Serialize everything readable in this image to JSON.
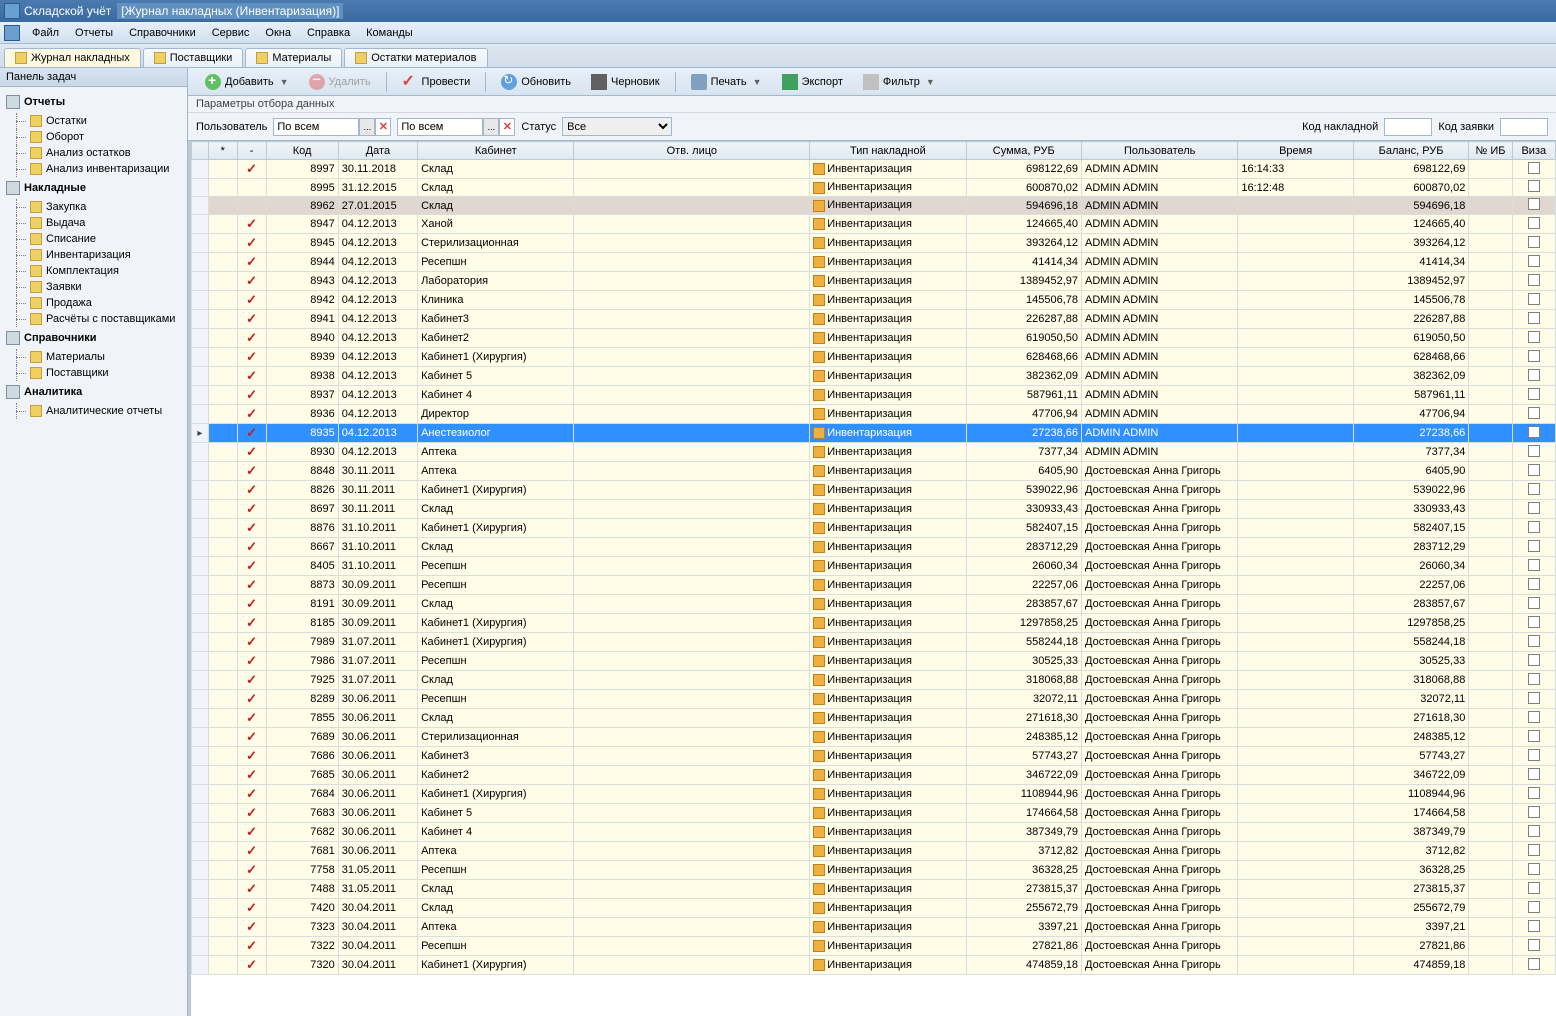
{
  "window": {
    "app_title": "Складской учёт",
    "doc_title": "[Журнал накладных (Инвентаризация)]"
  },
  "menu": [
    "Файл",
    "Отчеты",
    "Справочники",
    "Сервис",
    "Окна",
    "Справка",
    "Команды"
  ],
  "tabs": [
    {
      "label": "Журнал накладных",
      "active": true
    },
    {
      "label": "Поставщики",
      "active": false
    },
    {
      "label": "Материалы",
      "active": false
    },
    {
      "label": "Остатки материалов",
      "active": false
    }
  ],
  "task_panel": {
    "header": "Панель задач",
    "groups": [
      {
        "label": "Отчеты",
        "items": [
          "Остатки",
          "Оборот",
          "Анализ остатков",
          "Анализ инвентаризации"
        ]
      },
      {
        "label": "Накладные",
        "items": [
          "Закупка",
          "Выдача",
          "Списание",
          "Инвентаризация",
          "Комплектация",
          "Заявки",
          "Продажа",
          "Расчёты с поставщиками"
        ]
      },
      {
        "label": "Справочники",
        "items": [
          "Материалы",
          "Поставщики"
        ]
      },
      {
        "label": "Аналитика",
        "items": [
          "Аналитические отчеты"
        ]
      }
    ]
  },
  "toolbar": {
    "add": "Добавить",
    "delete": "Удалить",
    "post": "Провести",
    "refresh": "Обновить",
    "draft": "Черновик",
    "print": "Печать",
    "export": "Экспорт",
    "filter": "Фильтр"
  },
  "filter": {
    "section_label": "Параметры отбора данных",
    "user_label": "Пользователь",
    "user_value": "По всем",
    "second_value": "По всем",
    "status_label": "Статус",
    "status_value": "Все",
    "code_label": "Код накладной",
    "code_value": "",
    "req_label": "Код заявки",
    "req_value": ""
  },
  "grid": {
    "headers": {
      "star": "*",
      "dash": "-",
      "code": "Код",
      "date": "Дата",
      "cab": "Кабинет",
      "resp": "Отв. лицо",
      "type": "Тип накладной",
      "sum": "Сумма, РУБ",
      "user": "Пользователь",
      "time": "Время",
      "bal": "Баланс, РУБ",
      "ib": "№ ИБ",
      "visa": "Виза"
    },
    "selected_code": "8935",
    "special_code": "8962",
    "rows": [
      {
        "chk": true,
        "code": "8997",
        "date": "30.11.2018",
        "cab": "Склад",
        "type": "Инвентаризация",
        "sum": "698122,69",
        "user": "ADMIN ADMIN",
        "time": "16:14:33",
        "bal": "698122,69"
      },
      {
        "chk": false,
        "code": "8995",
        "date": "31.12.2015",
        "cab": "Склад",
        "type": "Инвентаризация",
        "sum": "600870,02",
        "user": "ADMIN ADMIN",
        "time": "16:12:48",
        "bal": "600870,02"
      },
      {
        "chk": false,
        "code": "8962",
        "date": "27.01.2015",
        "cab": "Склад",
        "type": "Инвентаризация",
        "sum": "594696,18",
        "user": "ADMIN ADMIN",
        "time": "",
        "bal": "594696,18"
      },
      {
        "chk": true,
        "code": "8947",
        "date": "04.12.2013",
        "cab": "Ханой",
        "type": "Инвентаризация",
        "sum": "124665,40",
        "user": "ADMIN ADMIN",
        "time": "",
        "bal": "124665,40"
      },
      {
        "chk": true,
        "code": "8945",
        "date": "04.12.2013",
        "cab": "Стерилизационная",
        "type": "Инвентаризация",
        "sum": "393264,12",
        "user": "ADMIN ADMIN",
        "time": "",
        "bal": "393264,12"
      },
      {
        "chk": true,
        "code": "8944",
        "date": "04.12.2013",
        "cab": "Ресепшн",
        "type": "Инвентаризация",
        "sum": "41414,34",
        "user": "ADMIN ADMIN",
        "time": "",
        "bal": "41414,34"
      },
      {
        "chk": true,
        "code": "8943",
        "date": "04.12.2013",
        "cab": "Лаборатория",
        "type": "Инвентаризация",
        "sum": "1389452,97",
        "user": "ADMIN ADMIN",
        "time": "",
        "bal": "1389452,97"
      },
      {
        "chk": true,
        "code": "8942",
        "date": "04.12.2013",
        "cab": "Клиника",
        "type": "Инвентаризация",
        "sum": "145506,78",
        "user": "ADMIN ADMIN",
        "time": "",
        "bal": "145506,78"
      },
      {
        "chk": true,
        "code": "8941",
        "date": "04.12.2013",
        "cab": "Кабинет3",
        "type": "Инвентаризация",
        "sum": "226287,88",
        "user": "ADMIN ADMIN",
        "time": "",
        "bal": "226287,88"
      },
      {
        "chk": true,
        "code": "8940",
        "date": "04.12.2013",
        "cab": "Кабинет2",
        "type": "Инвентаризация",
        "sum": "619050,50",
        "user": "ADMIN ADMIN",
        "time": "",
        "bal": "619050,50"
      },
      {
        "chk": true,
        "code": "8939",
        "date": "04.12.2013",
        "cab": "Кабинет1 (Хирургия)",
        "type": "Инвентаризация",
        "sum": "628468,66",
        "user": "ADMIN ADMIN",
        "time": "",
        "bal": "628468,66"
      },
      {
        "chk": true,
        "code": "8938",
        "date": "04.12.2013",
        "cab": "Кабинет 5",
        "type": "Инвентаризация",
        "sum": "382362,09",
        "user": "ADMIN ADMIN",
        "time": "",
        "bal": "382362,09"
      },
      {
        "chk": true,
        "code": "8937",
        "date": "04.12.2013",
        "cab": "Кабинет 4",
        "type": "Инвентаризация",
        "sum": "587961,11",
        "user": "ADMIN ADMIN",
        "time": "",
        "bal": "587961,11"
      },
      {
        "chk": true,
        "code": "8936",
        "date": "04.12.2013",
        "cab": "Директор",
        "type": "Инвентаризация",
        "sum": "47706,94",
        "user": "ADMIN ADMIN",
        "time": "",
        "bal": "47706,94"
      },
      {
        "chk": true,
        "code": "8935",
        "date": "04.12.2013",
        "cab": "Анестезиолог",
        "type": "Инвентаризация",
        "sum": "27238,66",
        "user": "ADMIN ADMIN",
        "time": "",
        "bal": "27238,66"
      },
      {
        "chk": true,
        "code": "8930",
        "date": "04.12.2013",
        "cab": "Аптека",
        "type": "Инвентаризация",
        "sum": "7377,34",
        "user": "ADMIN ADMIN",
        "time": "",
        "bal": "7377,34"
      },
      {
        "chk": true,
        "code": "8848",
        "date": "30.11.2011",
        "cab": "Аптека",
        "type": "Инвентаризация",
        "sum": "6405,90",
        "user": "Достоевская Анна Григорь",
        "time": "",
        "bal": "6405,90"
      },
      {
        "chk": true,
        "code": "8826",
        "date": "30.11.2011",
        "cab": "Кабинет1 (Хирургия)",
        "type": "Инвентаризация",
        "sum": "539022,96",
        "user": "Достоевская Анна Григорь",
        "time": "",
        "bal": "539022,96"
      },
      {
        "chk": true,
        "code": "8697",
        "date": "30.11.2011",
        "cab": "Склад",
        "type": "Инвентаризация",
        "sum": "330933,43",
        "user": "Достоевская Анна Григорь",
        "time": "",
        "bal": "330933,43"
      },
      {
        "chk": true,
        "code": "8876",
        "date": "31.10.2011",
        "cab": "Кабинет1 (Хирургия)",
        "type": "Инвентаризация",
        "sum": "582407,15",
        "user": "Достоевская Анна Григорь",
        "time": "",
        "bal": "582407,15"
      },
      {
        "chk": true,
        "code": "8667",
        "date": "31.10.2011",
        "cab": "Склад",
        "type": "Инвентаризация",
        "sum": "283712,29",
        "user": "Достоевская Анна Григорь",
        "time": "",
        "bal": "283712,29"
      },
      {
        "chk": true,
        "code": "8405",
        "date": "31.10.2011",
        "cab": "Ресепшн",
        "type": "Инвентаризация",
        "sum": "26060,34",
        "user": "Достоевская Анна Григорь",
        "time": "",
        "bal": "26060,34"
      },
      {
        "chk": true,
        "code": "8873",
        "date": "30.09.2011",
        "cab": "Ресепшн",
        "type": "Инвентаризация",
        "sum": "22257,06",
        "user": "Достоевская Анна Григорь",
        "time": "",
        "bal": "22257,06"
      },
      {
        "chk": true,
        "code": "8191",
        "date": "30.09.2011",
        "cab": "Склад",
        "type": "Инвентаризация",
        "sum": "283857,67",
        "user": "Достоевская Анна Григорь",
        "time": "",
        "bal": "283857,67"
      },
      {
        "chk": true,
        "code": "8185",
        "date": "30.09.2011",
        "cab": "Кабинет1 (Хирургия)",
        "type": "Инвентаризация",
        "sum": "1297858,25",
        "user": "Достоевская Анна Григорь",
        "time": "",
        "bal": "1297858,25"
      },
      {
        "chk": true,
        "code": "7989",
        "date": "31.07.2011",
        "cab": "Кабинет1 (Хирургия)",
        "type": "Инвентаризация",
        "sum": "558244,18",
        "user": "Достоевская Анна Григорь",
        "time": "",
        "bal": "558244,18"
      },
      {
        "chk": true,
        "code": "7986",
        "date": "31.07.2011",
        "cab": "Ресепшн",
        "type": "Инвентаризация",
        "sum": "30525,33",
        "user": "Достоевская Анна Григорь",
        "time": "",
        "bal": "30525,33"
      },
      {
        "chk": true,
        "code": "7925",
        "date": "31.07.2011",
        "cab": "Склад",
        "type": "Инвентаризация",
        "sum": "318068,88",
        "user": "Достоевская Анна Григорь",
        "time": "",
        "bal": "318068,88"
      },
      {
        "chk": true,
        "code": "8289",
        "date": "30.06.2011",
        "cab": "Ресепшн",
        "type": "Инвентаризация",
        "sum": "32072,11",
        "user": "Достоевская Анна Григорь",
        "time": "",
        "bal": "32072,11"
      },
      {
        "chk": true,
        "code": "7855",
        "date": "30.06.2011",
        "cab": "Склад",
        "type": "Инвентаризация",
        "sum": "271618,30",
        "user": "Достоевская Анна Григорь",
        "time": "",
        "bal": "271618,30"
      },
      {
        "chk": true,
        "code": "7689",
        "date": "30.06.2011",
        "cab": "Стерилизационная",
        "type": "Инвентаризация",
        "sum": "248385,12",
        "user": "Достоевская Анна Григорь",
        "time": "",
        "bal": "248385,12"
      },
      {
        "chk": true,
        "code": "7686",
        "date": "30.06.2011",
        "cab": "Кабинет3",
        "type": "Инвентаризация",
        "sum": "57743,27",
        "user": "Достоевская Анна Григорь",
        "time": "",
        "bal": "57743,27"
      },
      {
        "chk": true,
        "code": "7685",
        "date": "30.06.2011",
        "cab": "Кабинет2",
        "type": "Инвентаризация",
        "sum": "346722,09",
        "user": "Достоевская Анна Григорь",
        "time": "",
        "bal": "346722,09"
      },
      {
        "chk": true,
        "code": "7684",
        "date": "30.06.2011",
        "cab": "Кабинет1 (Хирургия)",
        "type": "Инвентаризация",
        "sum": "1108944,96",
        "user": "Достоевская Анна Григорь",
        "time": "",
        "bal": "1108944,96"
      },
      {
        "chk": true,
        "code": "7683",
        "date": "30.06.2011",
        "cab": "Кабинет 5",
        "type": "Инвентаризация",
        "sum": "174664,58",
        "user": "Достоевская Анна Григорь",
        "time": "",
        "bal": "174664,58"
      },
      {
        "chk": true,
        "code": "7682",
        "date": "30.06.2011",
        "cab": "Кабинет 4",
        "type": "Инвентаризация",
        "sum": "387349,79",
        "user": "Достоевская Анна Григорь",
        "time": "",
        "bal": "387349,79"
      },
      {
        "chk": true,
        "code": "7681",
        "date": "30.06.2011",
        "cab": "Аптека",
        "type": "Инвентаризация",
        "sum": "3712,82",
        "user": "Достоевская Анна Григорь",
        "time": "",
        "bal": "3712,82"
      },
      {
        "chk": true,
        "code": "7758",
        "date": "31.05.2011",
        "cab": "Ресепшн",
        "type": "Инвентаризация",
        "sum": "36328,25",
        "user": "Достоевская Анна Григорь",
        "time": "",
        "bal": "36328,25"
      },
      {
        "chk": true,
        "code": "7488",
        "date": "31.05.2011",
        "cab": "Склад",
        "type": "Инвентаризация",
        "sum": "273815,37",
        "user": "Достоевская Анна Григорь",
        "time": "",
        "bal": "273815,37"
      },
      {
        "chk": true,
        "code": "7420",
        "date": "30.04.2011",
        "cab": "Склад",
        "type": "Инвентаризация",
        "sum": "255672,79",
        "user": "Достоевская Анна Григорь",
        "time": "",
        "bal": "255672,79"
      },
      {
        "chk": true,
        "code": "7323",
        "date": "30.04.2011",
        "cab": "Аптека",
        "type": "Инвентаризация",
        "sum": "3397,21",
        "user": "Достоевская Анна Григорь",
        "time": "",
        "bal": "3397,21"
      },
      {
        "chk": true,
        "code": "7322",
        "date": "30.04.2011",
        "cab": "Ресепшн",
        "type": "Инвентаризация",
        "sum": "27821,86",
        "user": "Достоевская Анна Григорь",
        "time": "",
        "bal": "27821,86"
      },
      {
        "chk": true,
        "code": "7320",
        "date": "30.04.2011",
        "cab": "Кабинет1 (Хирургия)",
        "type": "Инвентаризация",
        "sum": "474859,18",
        "user": "Достоевская Анна Григорь",
        "time": "",
        "bal": "474859,18"
      }
    ]
  }
}
